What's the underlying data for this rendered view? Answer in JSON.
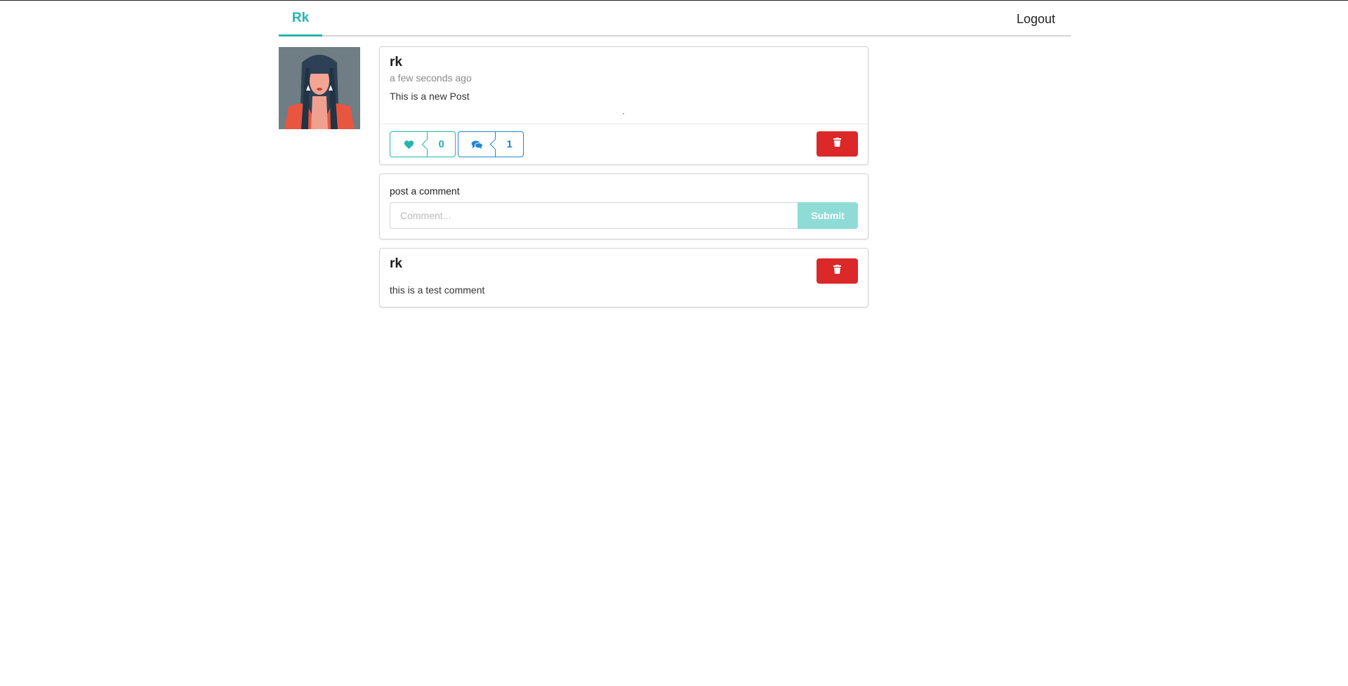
{
  "menu": {
    "brand": "Rk",
    "logout": "Logout"
  },
  "post": {
    "author": "rk",
    "time": "a few seconds ago",
    "body": "This is a new Post",
    "like_icon": "heart-icon",
    "like_count": "0",
    "comment_icon": "comments-icon",
    "comment_count": "1",
    "delete_icon": "trash-icon"
  },
  "comment_form": {
    "label": "post a comment",
    "placeholder": "Comment...",
    "submit": "Submit"
  },
  "comments": [
    {
      "author": "rk",
      "body": "this is a test comment",
      "delete_icon": "trash-icon"
    }
  ],
  "colors": {
    "accent": "#26b5ad",
    "comment_blue": "#2185d0",
    "danger": "#db2828",
    "submit_disabled": "#8fdcd7"
  }
}
